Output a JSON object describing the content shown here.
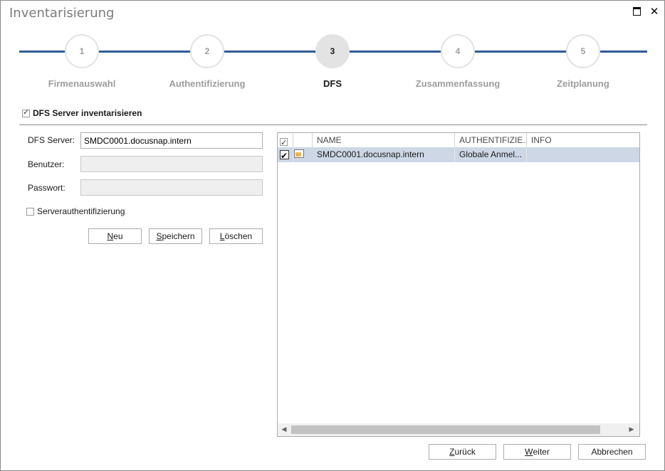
{
  "window": {
    "title": "Inventarisierung",
    "maximize_icon": "maximize-icon",
    "close_glyph": "✕"
  },
  "steps": [
    {
      "number": "1",
      "label": "Firmenauswahl",
      "active": false
    },
    {
      "number": "2",
      "label": "Authentifizierung",
      "active": false
    },
    {
      "number": "3",
      "label": "DFS",
      "active": true
    },
    {
      "number": "4",
      "label": "Zusammenfassung",
      "active": false
    },
    {
      "number": "5",
      "label": "Zeitplanung",
      "active": false
    }
  ],
  "dfs_section": {
    "toggle_label": "DFS Server inventarisieren",
    "toggle_checked": true
  },
  "form": {
    "server_label": "DFS Server:",
    "server_value": "SMDC0001.docusnap.intern",
    "user_label": "Benutzer:",
    "user_value": "",
    "password_label": "Passwort:",
    "password_value": "",
    "server_auth_label": "Serverauthentifizierung",
    "server_auth_checked": false,
    "buttons": {
      "new_mnemonic": "N",
      "new_rest": "eu",
      "save_mnemonic": "S",
      "save_rest": "peichern",
      "delete_mnemonic": "L",
      "delete_rest": "öschen"
    }
  },
  "grid": {
    "columns": [
      "",
      "",
      "NAME",
      "AUTHENTIFIZIE...",
      "INFO"
    ],
    "rows": [
      {
        "checked": true,
        "icon": "server-icon",
        "name": "SMDC0001.docusnap.intern",
        "auth": "Globale Anmel...",
        "info": ""
      }
    ],
    "scroll_left": "◀",
    "scroll_right": "▶"
  },
  "footer": {
    "back_mnemonic": "Z",
    "back_rest": "urück",
    "next_mnemonic": "W",
    "next_rest": "eiter",
    "cancel_label": "Abbrechen"
  },
  "colors": {
    "accent": "#2f5b97",
    "selection": "#cdd7e6",
    "step_inactive": "#9d9d9d"
  }
}
